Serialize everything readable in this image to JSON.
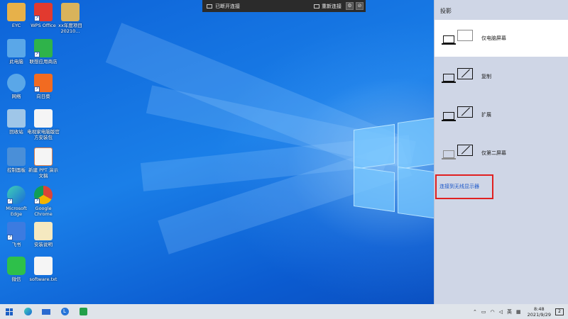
{
  "desktop": {
    "icons": [
      {
        "label": "EYC",
        "color": "#e7b14a"
      },
      {
        "label": "WPS Office",
        "color": "#e23a2f"
      },
      {
        "label": "xx年度项目20210...",
        "color": "#d9b35b"
      },
      {
        "label": "此电脑",
        "color": "#5aa7e8"
      },
      {
        "label": "联想应用商店",
        "color": "#2fb34a"
      },
      {
        "label": "网络",
        "color": "#5aa7e8"
      },
      {
        "label": "向日葵",
        "color": "#f26b21"
      },
      {
        "label": "回收站",
        "color": "#9fc6e8"
      },
      {
        "label": "电视家电脑版官方安装包",
        "color": "#f5f5f5"
      },
      {
        "label": "控制面板",
        "color": "#4a8fd8"
      },
      {
        "label": "新建 PPT 演示文稿",
        "color": "#f5f5f5"
      },
      {
        "label": "Microsoft Edge",
        "color": "#1fa6c8"
      },
      {
        "label": "Google Chrome",
        "color": "#e8a33a"
      },
      {
        "label": "飞书",
        "color": "#3c7be0"
      },
      {
        "label": "安装说明",
        "color": "#f5e9c0"
      },
      {
        "label": "微信",
        "color": "#2ec04a"
      },
      {
        "label": "software.txt",
        "color": "#f5f5f5"
      }
    ]
  },
  "rdp_bar": {
    "status": "已断开连接",
    "reconnect": "重新连接"
  },
  "project_panel": {
    "title": "投影",
    "options": [
      {
        "label": "仅电脑屏幕",
        "selected": true
      },
      {
        "label": "复制",
        "selected": false
      },
      {
        "label": "扩展",
        "selected": false
      },
      {
        "label": "仅第二屏幕",
        "selected": false
      }
    ],
    "wireless_link": "连接到无线显示器"
  },
  "taskbar": {
    "tray_language": "英",
    "time": "8:48",
    "date": "2021/9/29",
    "notification_count": "2",
    "tray_icons": [
      "chevron-up-icon",
      "battery-icon",
      "wifi-icon",
      "volume-icon"
    ]
  },
  "colors": {
    "highlight": "#e02020",
    "link": "#1a56c8",
    "panel_bg": "#cfd6e6"
  }
}
